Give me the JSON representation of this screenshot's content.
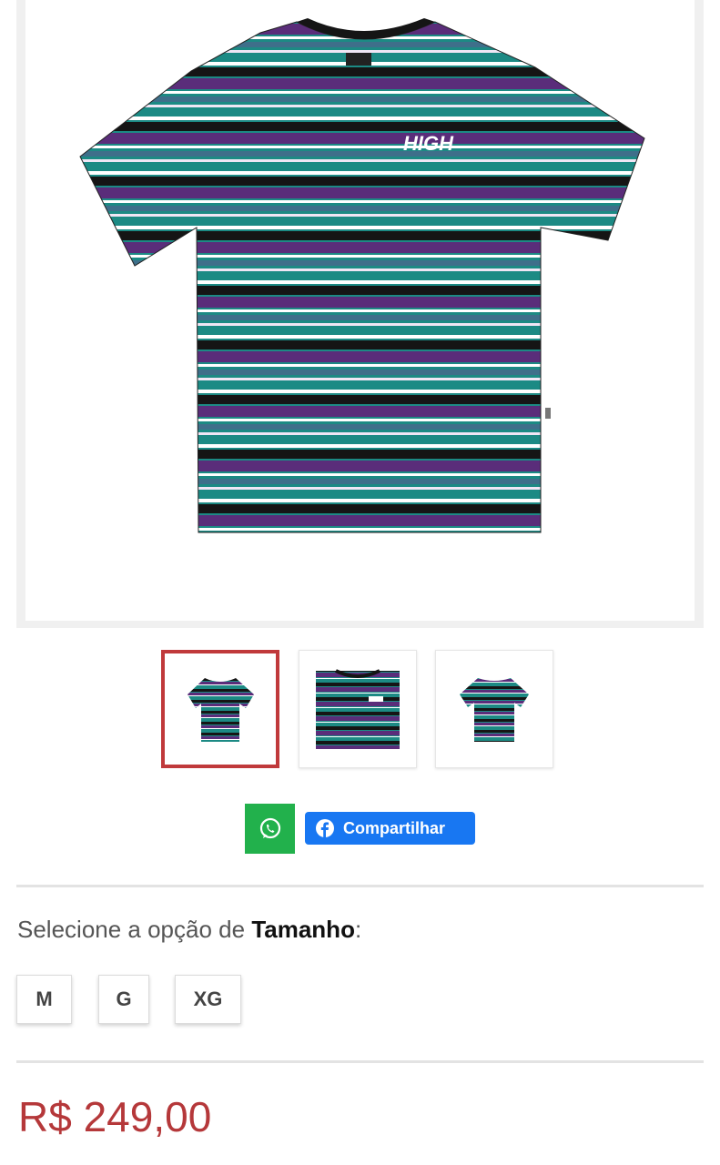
{
  "product": {
    "main_image": {
      "alt": "HIGH",
      "logo_text": "HIGH",
      "colors": [
        "#1c8a84",
        "#5a2d7a",
        "#151515",
        "#ffffff"
      ]
    },
    "thumbnails": [
      {
        "label": "thumbnail-front",
        "selected": true
      },
      {
        "label": "thumbnail-detail",
        "selected": false
      },
      {
        "label": "thumbnail-back",
        "selected": false
      }
    ],
    "share": {
      "whatsapp_icon": "whatsapp-icon",
      "facebook_icon": "facebook-icon",
      "facebook_label": "Compartilhar"
    },
    "option": {
      "prompt_prefix": "Selecione a opção de ",
      "option_name": "Tamanho",
      "prompt_suffix": ":"
    },
    "sizes": [
      "M",
      "G",
      "XG"
    ],
    "price": "R$ 249,00",
    "accent_color": "#c0393b",
    "price_color": "#b5383a"
  }
}
